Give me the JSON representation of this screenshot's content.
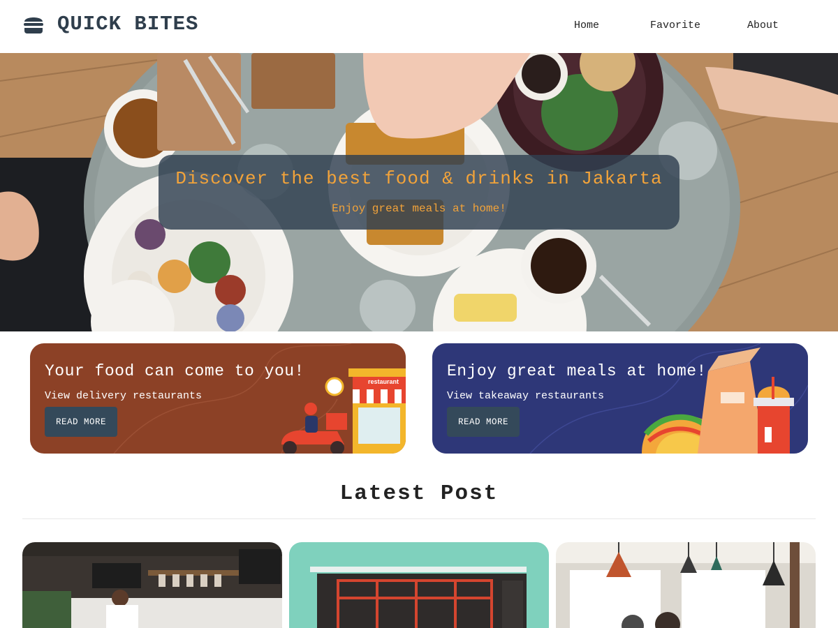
{
  "header": {
    "brand": "QUICK BITES",
    "brand_icon": "burger-icon",
    "nav": [
      "Home",
      "Favorite",
      "About"
    ]
  },
  "hero": {
    "title": "Discover the best food & drinks in Jakarta",
    "subtitle": "Enjoy great meals at home!"
  },
  "promos": [
    {
      "title": "Your food can come to you!",
      "subtitle": "View delivery restaurants",
      "button": "READ MORE",
      "sign_text": "restaurant"
    },
    {
      "title": "Enjoy great meals at home!",
      "subtitle": "View takeaway restaurants",
      "button": "READ MORE"
    }
  ],
  "latest": {
    "title": "Latest Post"
  },
  "colors": {
    "accent": "#f2a33a",
    "delivery_card": "#8c4126",
    "takeaway_card": "#2e3778",
    "button": "#34495a",
    "brand_text": "#2f3e4c"
  }
}
